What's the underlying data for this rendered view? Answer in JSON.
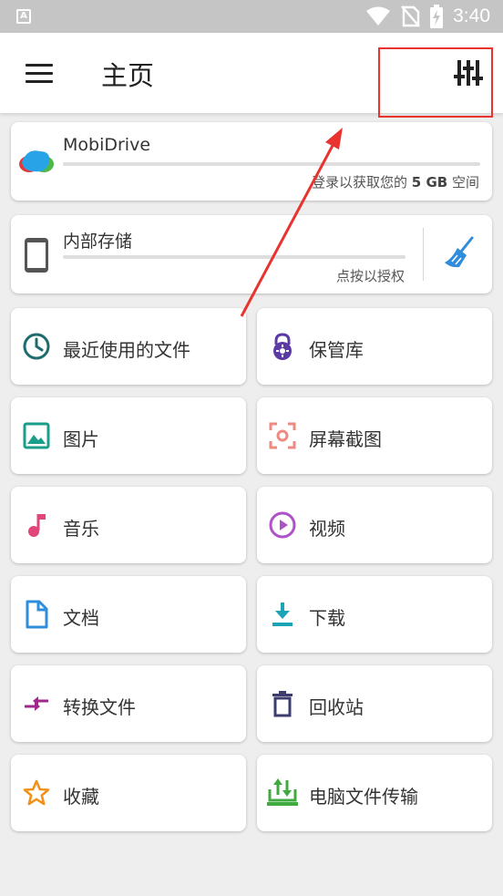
{
  "status_bar": {
    "time": "3:40",
    "notification_glyph": "A"
  },
  "app_bar": {
    "title": "主页",
    "menu_icon": "hamburger-menu-icon",
    "filter_icon": "sliders-filter-icon"
  },
  "cloud_storage": {
    "name": "MobiDrive",
    "subtitle_prefix": "登录以获取您的",
    "subtitle_bold": "5 GB",
    "subtitle_suffix": "空间"
  },
  "internal_storage": {
    "name": "内部存储",
    "subtitle": "点按以授权",
    "clean_icon": "broom-clean-icon"
  },
  "categories": [
    {
      "label": "最近使用的文件",
      "icon": "clock-icon",
      "color": "#1e6c6e"
    },
    {
      "label": "保管库",
      "icon": "lock-icon",
      "color": "#5b3aa6"
    },
    {
      "label": "图片",
      "icon": "image-icon",
      "color": "#1a9e8c"
    },
    {
      "label": "屏幕截图",
      "icon": "screenshot-icon",
      "color": "#ef8a80"
    },
    {
      "label": "音乐",
      "icon": "music-note-icon",
      "color": "#e0467a"
    },
    {
      "label": "视频",
      "icon": "play-circle-icon",
      "color": "#ad52c9"
    },
    {
      "label": "文档",
      "icon": "document-icon",
      "color": "#2f8ddc"
    },
    {
      "label": "下载",
      "icon": "download-icon",
      "color": "#1aa5b7"
    },
    {
      "label": "转换文件",
      "icon": "convert-arrows-icon",
      "color": "#a0288c"
    },
    {
      "label": "回收站",
      "icon": "trash-icon",
      "color": "#3c3c6e"
    },
    {
      "label": "收藏",
      "icon": "star-icon",
      "color": "#f2921d"
    },
    {
      "label": "电脑文件传输",
      "icon": "pc-transfer-icon",
      "color": "#3faa3f"
    }
  ],
  "colors": {
    "annotation_red": "#e8332f",
    "cloud_blue": "#29a3e8",
    "cloud_red": "#e23b3b",
    "cloud_green": "#4cb74a"
  }
}
